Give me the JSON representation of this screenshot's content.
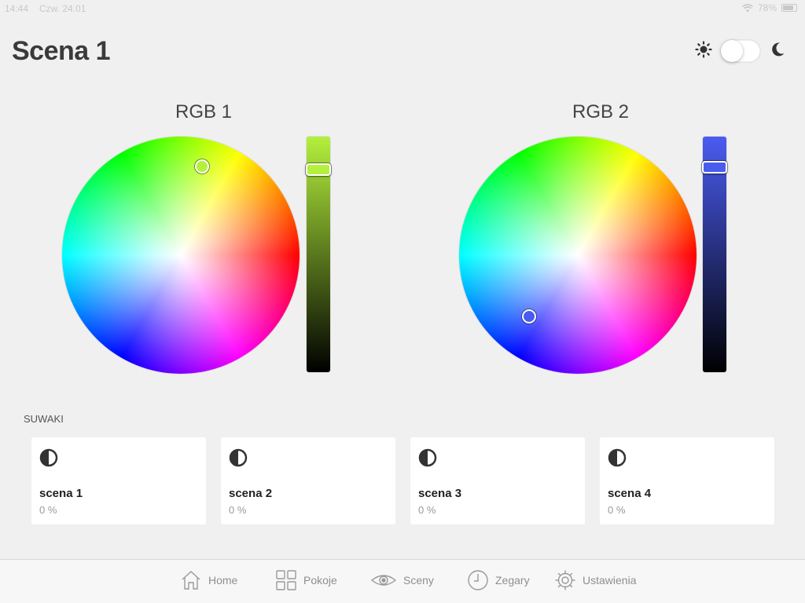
{
  "status_bar": {
    "time": "14:44",
    "date": "Czw. 24.01",
    "battery": "78%"
  },
  "header": {
    "title": "Scena 1"
  },
  "mode_toggle": {
    "light_icon": "sun-icon",
    "dark_icon": "moon-icon",
    "dark_mode_on": false
  },
  "rgb_controls": [
    {
      "label": "RGB 1",
      "selected_color": "#b4f03c",
      "slider_top_color": "#b4f03c",
      "brightness_fraction": 0.86
    },
    {
      "label": "RGB 2",
      "selected_color": "#4a5cf0",
      "slider_top_color": "#4a5cf0",
      "brightness_fraction": 0.87
    }
  ],
  "sliders_section": {
    "label": "SUWAKI",
    "items": [
      {
        "title": "scena 1",
        "value": "0 %",
        "icon": "half-circle-icon"
      },
      {
        "title": "scena 2",
        "value": "0 %",
        "icon": "half-circle-icon"
      },
      {
        "title": "scena 3",
        "value": "0 %",
        "icon": "half-circle-icon"
      },
      {
        "title": "scena 4",
        "value": "0 %",
        "icon": "half-circle-icon"
      }
    ]
  },
  "tab_bar": {
    "items": [
      {
        "label": "Home",
        "icon": "home-icon"
      },
      {
        "label": "Pokoje",
        "icon": "grid-icon"
      },
      {
        "label": "Sceny",
        "icon": "eye-icon"
      },
      {
        "label": "Zegary",
        "icon": "clock-icon"
      },
      {
        "label": "Ustawienia",
        "icon": "gear-icon"
      }
    ]
  },
  "colors": {
    "background": "#f0f0f0",
    "card": "#ffffff",
    "tab_text": "#8e8e8e"
  }
}
